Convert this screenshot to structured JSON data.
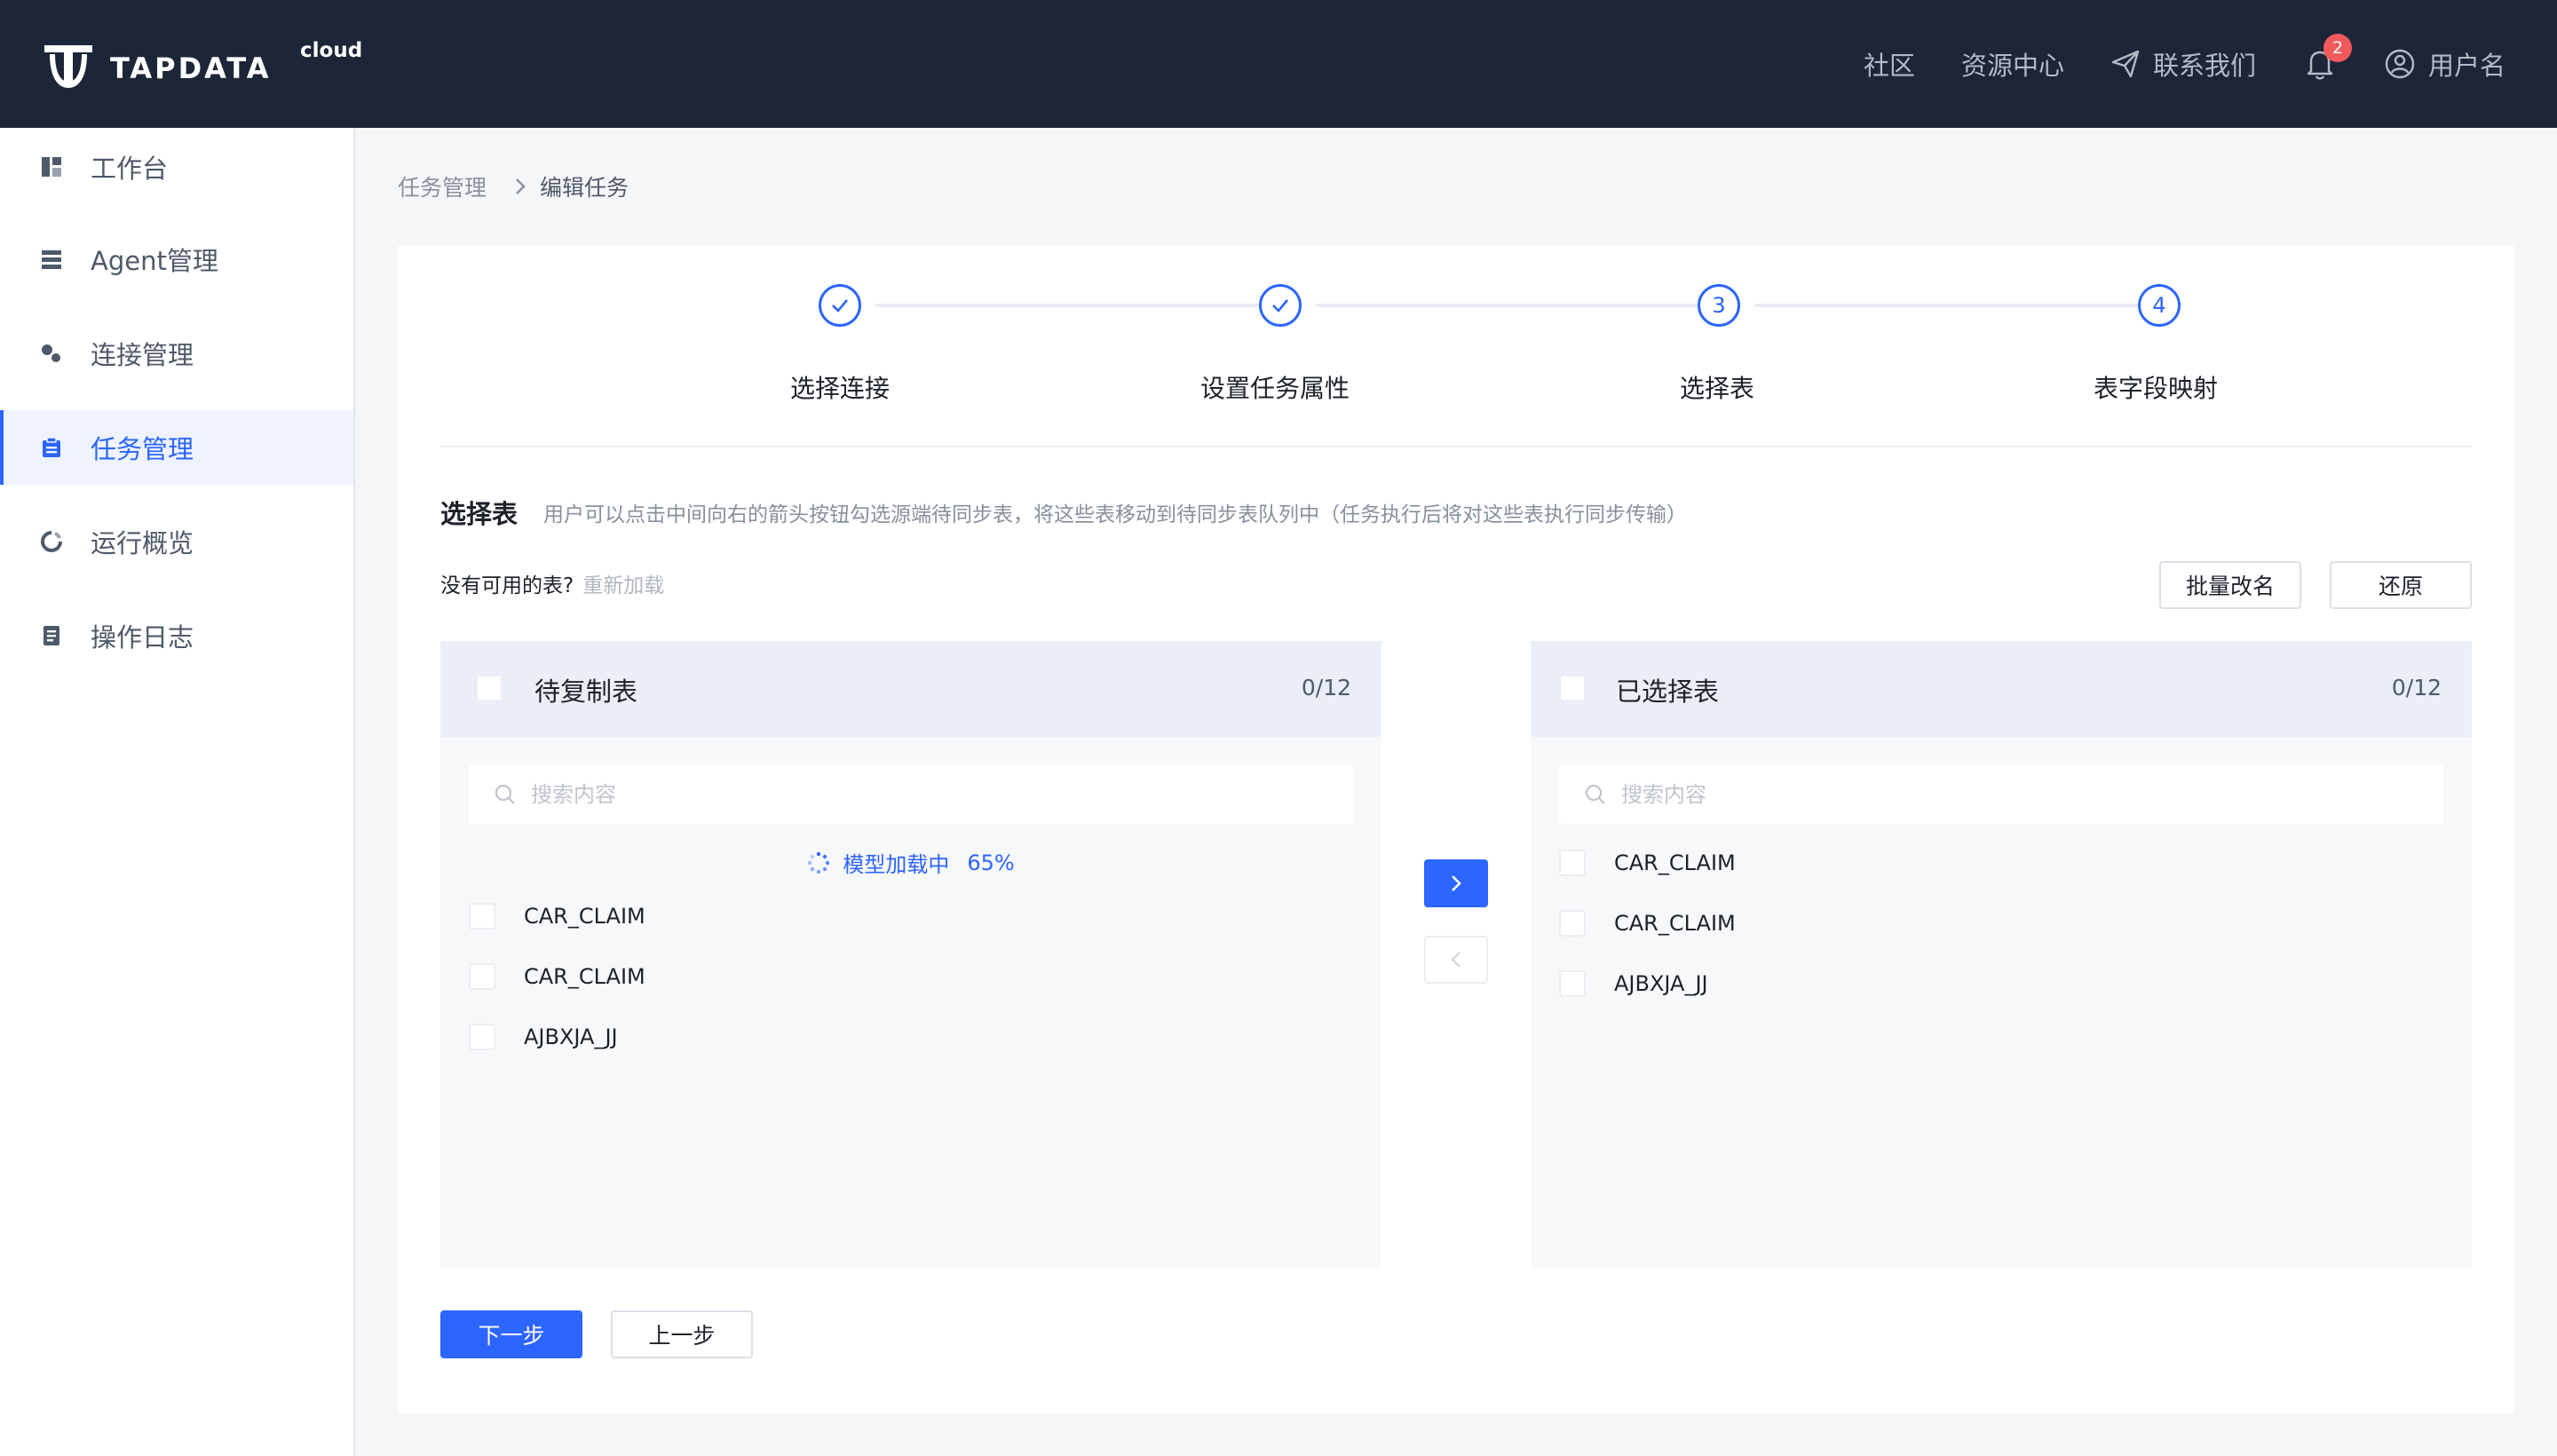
{
  "brand": {
    "name": "TAPDATA",
    "suffix": "cloud"
  },
  "colors": {
    "accent": "#2c65ff",
    "topbar": "#1d2638",
    "badge": "#f05a5a"
  },
  "topnav": {
    "community": "社区",
    "resources": "资源中心",
    "contact": "联系我们",
    "notification_count": "2",
    "username": "用户名"
  },
  "sidebar": {
    "items": [
      {
        "label": "工作台",
        "icon": "dashboard-icon"
      },
      {
        "label": "Agent管理",
        "icon": "server-icon"
      },
      {
        "label": "连接管理",
        "icon": "connection-icon"
      },
      {
        "label": "任务管理",
        "icon": "clipboard-icon",
        "active": true
      },
      {
        "label": "运行概览",
        "icon": "pie-progress-icon"
      },
      {
        "label": "操作日志",
        "icon": "log-icon"
      }
    ]
  },
  "breadcrumb": {
    "parent": "任务管理",
    "current": "编辑任务"
  },
  "steps": [
    {
      "label": "选择连接",
      "status": "done",
      "marker": ""
    },
    {
      "label": "设置任务属性",
      "status": "done",
      "marker": ""
    },
    {
      "label": "选择表",
      "status": "current",
      "marker": "3"
    },
    {
      "label": "表字段映射",
      "status": "pending",
      "marker": "4"
    }
  ],
  "section": {
    "title": "选择表",
    "description": "用户可以点击中间向右的箭头按钮勾选源端待同步表，将这些表移动到待同步表队列中（任务执行后将对这些表执行同步传输）",
    "no_tables": "没有可用的表?",
    "reload": "重新加载",
    "batch_rename": "批量改名",
    "restore": "还原"
  },
  "source_panel": {
    "title": "待复制表",
    "count": "0/12",
    "search_placeholder": "搜索内容",
    "loading_text": "模型加载中",
    "loading_percent": "65%",
    "items": [
      "CAR_CLAIM",
      "CAR_CLAIM",
      "AJBXJA_JJ"
    ]
  },
  "target_panel": {
    "title": "已选择表",
    "count": "0/12",
    "search_placeholder": "搜索内容",
    "items": [
      "CAR_CLAIM",
      "CAR_CLAIM",
      "AJBXJA_JJ"
    ]
  },
  "footer": {
    "next": "下一步",
    "prev": "上一步"
  }
}
